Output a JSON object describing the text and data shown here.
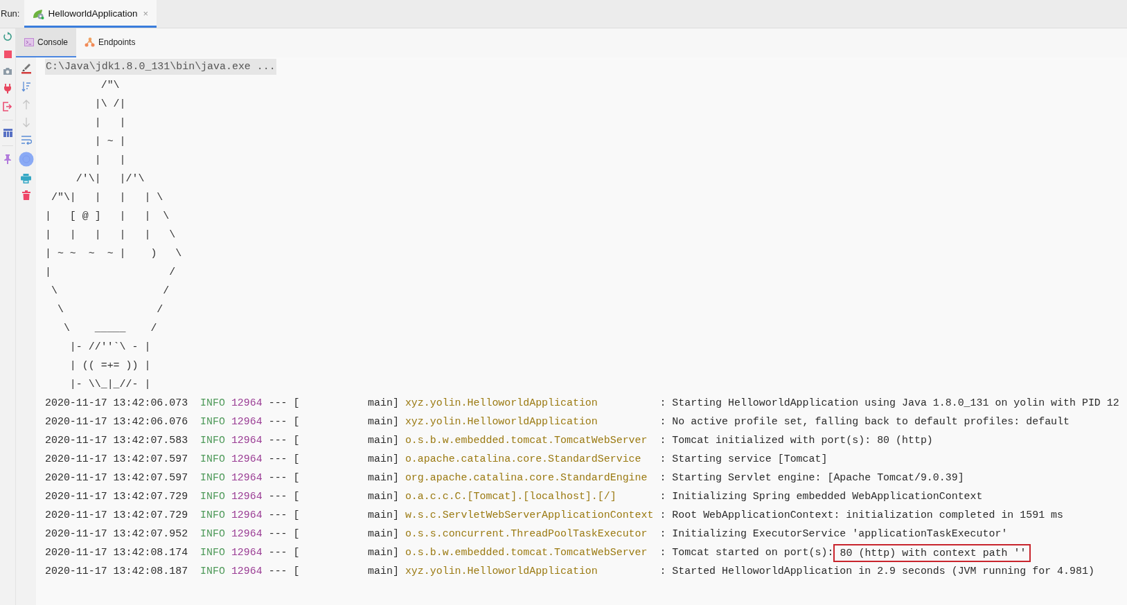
{
  "run_label": "Run:",
  "run_tabs": [
    {
      "label": "HelloworldApplication",
      "selected": true,
      "close": "×"
    }
  ],
  "sub_tabs": [
    {
      "label": "Console",
      "selected": true,
      "kind": "console"
    },
    {
      "label": "Endpoints",
      "selected": false,
      "kind": "endpoints"
    }
  ],
  "console": {
    "command": "C:\\Java\\jdk1.8.0_131\\bin\\java.exe ...",
    "banner": [
      "         /\"\\",
      "        |\\ /|",
      "        |   |",
      "        | ~ |",
      "        |   |",
      "     /'\\|   |/'\\",
      " /\"\\|   |   |   | \\",
      "|   [ @ ]   |   |  \\",
      "|   |   |   |   |   \\",
      "| ~ ~  ~  ~ |    )   \\",
      "|                   /",
      " \\                 /",
      "  \\               /",
      "   \\    _____    /",
      "    |- //''`\\ - |",
      "    | (( =+= )) |",
      "    |- \\\\_|_//- |"
    ],
    "log": [
      {
        "timestamp": "2020-11-17 13:42:06.073",
        "level": "INFO",
        "pid": "12964",
        "separator": "--- [",
        "thread": "main]",
        "logger": "xyz.yolin.HelloworldApplication",
        "message": ": Starting HelloworldApplication using Java 1.8.0_131 on yolin with PID 12"
      },
      {
        "timestamp": "2020-11-17 13:42:06.076",
        "level": "INFO",
        "pid": "12964",
        "separator": "--- [",
        "thread": "main]",
        "logger": "xyz.yolin.HelloworldApplication",
        "message": ": No active profile set, falling back to default profiles: default"
      },
      {
        "timestamp": "2020-11-17 13:42:07.583",
        "level": "INFO",
        "pid": "12964",
        "separator": "--- [",
        "thread": "main]",
        "logger": "o.s.b.w.embedded.tomcat.TomcatWebServer",
        "message": ": Tomcat initialized with port(s): 80 (http)"
      },
      {
        "timestamp": "2020-11-17 13:42:07.597",
        "level": "INFO",
        "pid": "12964",
        "separator": "--- [",
        "thread": "main]",
        "logger": "o.apache.catalina.core.StandardService",
        "message": ": Starting service [Tomcat]"
      },
      {
        "timestamp": "2020-11-17 13:42:07.597",
        "level": "INFO",
        "pid": "12964",
        "separator": "--- [",
        "thread": "main]",
        "logger": "org.apache.catalina.core.StandardEngine",
        "message": ": Starting Servlet engine: [Apache Tomcat/9.0.39]"
      },
      {
        "timestamp": "2020-11-17 13:42:07.729",
        "level": "INFO",
        "pid": "12964",
        "separator": "--- [",
        "thread": "main]",
        "logger": "o.a.c.c.C.[Tomcat].[localhost].[/]",
        "message": ": Initializing Spring embedded WebApplicationContext"
      },
      {
        "timestamp": "2020-11-17 13:42:07.729",
        "level": "INFO",
        "pid": "12964",
        "separator": "--- [",
        "thread": "main]",
        "logger": "w.s.c.ServletWebServerApplicationContext",
        "message": ": Root WebApplicationContext: initialization completed in 1591 ms"
      },
      {
        "timestamp": "2020-11-17 13:42:07.952",
        "level": "INFO",
        "pid": "12964",
        "separator": "--- [",
        "thread": "main]",
        "logger": "o.s.s.concurrent.ThreadPoolTaskExecutor",
        "message": ": Initializing ExecutorService 'applicationTaskExecutor'"
      },
      {
        "timestamp": "2020-11-17 13:42:08.174",
        "level": "INFO",
        "pid": "12964",
        "separator": "--- [",
        "thread": "main]",
        "logger": "o.s.b.w.embedded.tomcat.TomcatWebServer",
        "message": ": Tomcat started on port(s):",
        "highlight": "80 (http) with context path ''"
      },
      {
        "timestamp": "2020-11-17 13:42:08.187",
        "level": "INFO",
        "pid": "12964",
        "separator": "--- [",
        "thread": "main]",
        "logger": "xyz.yolin.HelloworldApplication",
        "message": ": Started HelloworldApplication in 2.9 seconds (JVM running for 4.981)"
      }
    ]
  }
}
